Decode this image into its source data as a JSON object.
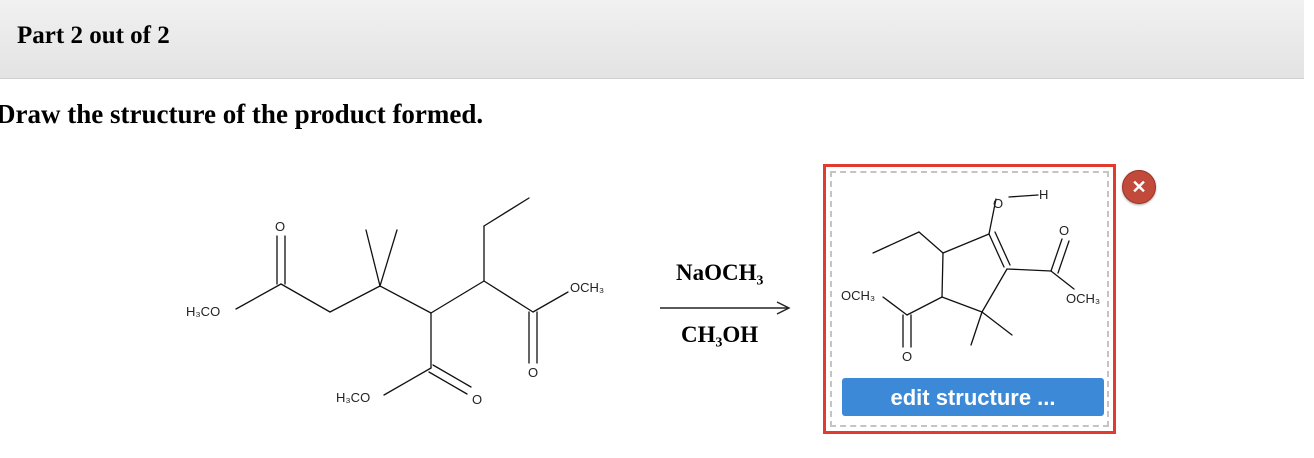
{
  "header": {
    "part_label": "Part 2 out of 2"
  },
  "question": {
    "prompt": "Draw the structure of the product formed."
  },
  "reactant": {
    "labels": {
      "top_left_ester": "H₃CO",
      "bottom_ester": "H₃CO",
      "right_ester": "OCH₃",
      "carbonyl_o": "O"
    }
  },
  "reagents": {
    "above_arrow": "NaOCH₃",
    "below_arrow": "CH₃OH"
  },
  "answer": {
    "labels": {
      "hydroxyl_o": "O",
      "hydroxyl_h": "H",
      "left_ester": "OCH₃",
      "right_ester": "OCH₃",
      "carbonyl_o": "O"
    },
    "edit_button_label": "edit structure ...",
    "close_icon_glyph": "✕"
  },
  "colors": {
    "answer_border": "#e23a2e",
    "edit_button_bg": "#3c8ad7",
    "close_bg": "#c14a3a"
  }
}
